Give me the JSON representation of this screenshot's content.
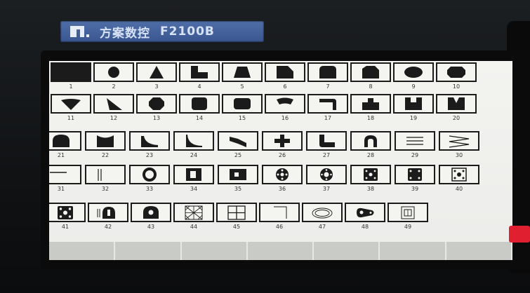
{
  "device": {
    "brand": "方案数控",
    "model": "F2100B"
  },
  "shapes": [
    {
      "n": "1",
      "icon": "blank-shape-icon"
    },
    {
      "n": "2",
      "icon": "circle-shape-icon"
    },
    {
      "n": "3",
      "icon": "triangle-shape-icon"
    },
    {
      "n": "4",
      "icon": "l-step-shape-icon"
    },
    {
      "n": "5",
      "icon": "trapezoid-shape-icon"
    },
    {
      "n": "6",
      "icon": "chamfer-corner-shape-icon"
    },
    {
      "n": "7",
      "icon": "rounded-top-rect-icon"
    },
    {
      "n": "8",
      "icon": "notched-rect-icon"
    },
    {
      "n": "9",
      "icon": "oval-shape-icon"
    },
    {
      "n": "10",
      "icon": "octagon-oval-icon"
    },
    {
      "n": "11",
      "icon": "sector-shape-icon"
    },
    {
      "n": "12",
      "icon": "slanted-wedge-icon"
    },
    {
      "n": "13",
      "icon": "octagon-shape-icon"
    },
    {
      "n": "14",
      "icon": "rounded-square-icon"
    },
    {
      "n": "15",
      "icon": "rounded-rect-icon"
    },
    {
      "n": "16",
      "icon": "arc-band-icon"
    },
    {
      "n": "17",
      "icon": "elbow-shape-icon"
    },
    {
      "n": "18",
      "icon": "t-base-shape-icon"
    },
    {
      "n": "19",
      "icon": "notched-top-rect-icon"
    },
    {
      "n": "20",
      "icon": "v-notch-rect-icon"
    },
    {
      "n": "21",
      "icon": "arch-shape-icon"
    },
    {
      "n": "22",
      "icon": "concave-top-rect-icon"
    },
    {
      "n": "23",
      "icon": "curved-ramp-icon"
    },
    {
      "n": "24",
      "icon": "steep-ramp-icon"
    },
    {
      "n": "25",
      "icon": "angled-band-icon"
    },
    {
      "n": "26",
      "icon": "cross-shape-icon"
    },
    {
      "n": "27",
      "icon": "l-rounded-shape-icon"
    },
    {
      "n": "28",
      "icon": "arch-outline-icon"
    },
    {
      "n": "29",
      "icon": "parallel-lines-icon"
    },
    {
      "n": "30",
      "icon": "zigzag-lines-icon"
    },
    {
      "n": "31",
      "icon": "horizontal-line-icon"
    },
    {
      "n": "32",
      "icon": "vertical-lines-icon"
    },
    {
      "n": "33",
      "icon": "ring-shape-icon"
    },
    {
      "n": "34",
      "icon": "square-with-hole-icon"
    },
    {
      "n": "35",
      "icon": "rect-with-hole-icon"
    },
    {
      "n": "36",
      "icon": "flange-circle-icon"
    },
    {
      "n": "37",
      "icon": "flange-ring-icon"
    },
    {
      "n": "38",
      "icon": "square-flange-icon"
    },
    {
      "n": "39",
      "icon": "square-four-holes-icon"
    },
    {
      "n": "40",
      "icon": "square-holes-outline-icon"
    },
    {
      "n": "41",
      "icon": "square-plate-holes-icon"
    },
    {
      "n": "42",
      "icon": "half-round-holes-icon"
    },
    {
      "n": "43",
      "icon": "rounded-bracket-icon"
    },
    {
      "n": "44",
      "icon": "hatched-grid-icon"
    },
    {
      "n": "45",
      "icon": "window-grid-icon"
    },
    {
      "n": "46",
      "icon": "corner-line-icon"
    },
    {
      "n": "47",
      "icon": "ellipse-ring-icon"
    },
    {
      "n": "48",
      "icon": "link-plate-icon"
    },
    {
      "n": "49",
      "icon": "nested-square-icon"
    }
  ],
  "colors": {
    "screen": "#eeeeea",
    "ink": "#1b1b1b",
    "label_bg": "#4563a0",
    "indicator": "#e02030"
  }
}
